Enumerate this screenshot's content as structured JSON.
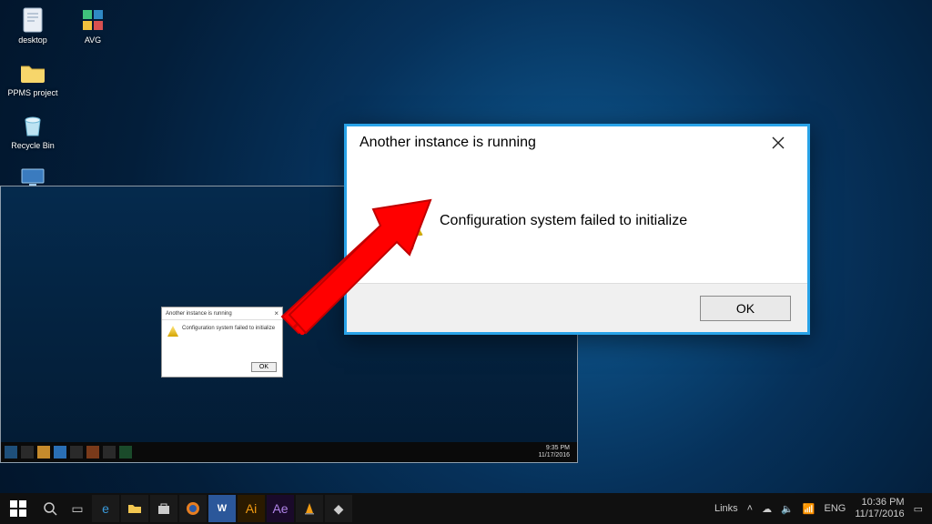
{
  "desktop": {
    "icons": [
      {
        "id": "desktop",
        "label": "desktop",
        "glyph": "generic"
      },
      {
        "id": "ppms",
        "label": "PPMS project",
        "glyph": "folder"
      },
      {
        "id": "recyclebin",
        "label": "Recycle Bin",
        "glyph": "recycle"
      },
      {
        "id": "thispc",
        "label": "This PC",
        "glyph": "pc"
      }
    ],
    "icons_col2": [
      {
        "id": "avg",
        "label": "AVG",
        "glyph": "avg"
      }
    ]
  },
  "inner_taskbar": {
    "time": "9:35 PM",
    "date": "11/17/2016"
  },
  "small_dialog": {
    "title": "Another instance is running",
    "message": "Configuration system failed to initialize",
    "ok": "OK"
  },
  "dialog": {
    "title": "Another instance is running",
    "message": "Configuration system failed to initialize",
    "ok": "OK"
  },
  "outer_taskbar": {
    "tray": {
      "links": "Links",
      "speaker": "🔈",
      "net": "📶",
      "lang": "ENG",
      "time": "10:36 PM",
      "date": "11/17/2016"
    }
  }
}
